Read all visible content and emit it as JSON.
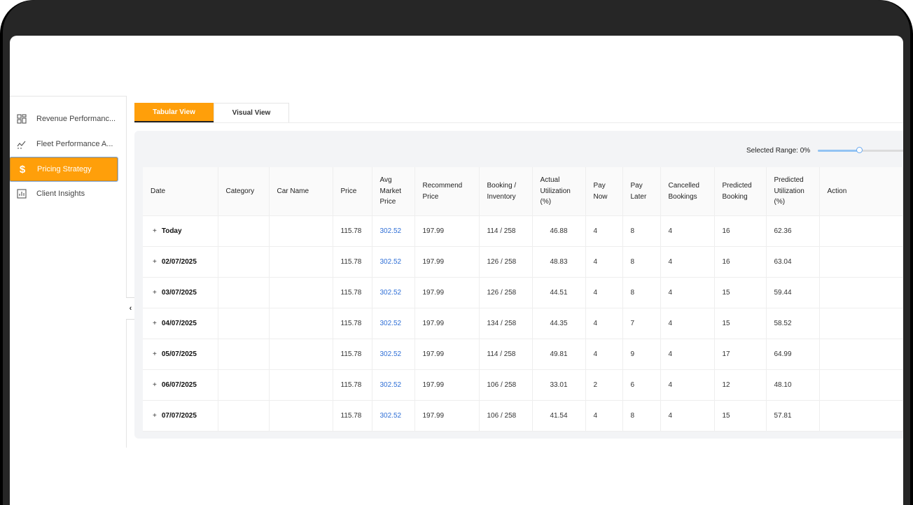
{
  "sidebar": {
    "items": [
      {
        "label": "Revenue Performanc...",
        "icon": "dashboard-grid-icon"
      },
      {
        "label": "Fleet Performance A...",
        "icon": "trend-line-icon"
      },
      {
        "label": "Pricing Strategy",
        "icon": "dollar-icon",
        "active": true
      },
      {
        "label": "Client Insights",
        "icon": "report-chart-icon"
      }
    ]
  },
  "collapse_glyph": "‹",
  "tabs": [
    {
      "label": "Tabular View",
      "active": true
    },
    {
      "label": "Visual View",
      "active": false
    }
  ],
  "range": {
    "label": "Selected Range: 0%",
    "value_percent": 0
  },
  "table": {
    "headers": [
      "Date",
      "Category",
      "Car Name",
      "Price",
      "Avg Market Price",
      "Recommend Price",
      "Booking / Inventory",
      "Actual Utilization (%)",
      "Pay Now",
      "Pay Later",
      "Cancelled Bookings",
      "Predicted Booking",
      "Predicted Utilization (%)",
      "Action"
    ],
    "expand_glyph": "+",
    "rows": [
      {
        "date": "Today",
        "category": "",
        "car_name": "",
        "price": "115.78",
        "avg_market": "302.52",
        "recommend": "197.99",
        "booking": "114 / 258",
        "actual_util": "46.88",
        "pay_now": "4",
        "pay_later": "8",
        "cancelled": "4",
        "pred_booking": "16",
        "pred_util": "62.36",
        "action": ""
      },
      {
        "date": "02/07/2025",
        "category": "",
        "car_name": "",
        "price": "115.78",
        "avg_market": "302.52",
        "recommend": "197.99",
        "booking": "126 / 258",
        "actual_util": "48.83",
        "pay_now": "4",
        "pay_later": "8",
        "cancelled": "4",
        "pred_booking": "16",
        "pred_util": "63.04",
        "action": ""
      },
      {
        "date": "03/07/2025",
        "category": "",
        "car_name": "",
        "price": "115.78",
        "avg_market": "302.52",
        "recommend": "197.99",
        "booking": "126 / 258",
        "actual_util": "44.51",
        "pay_now": "4",
        "pay_later": "8",
        "cancelled": "4",
        "pred_booking": "15",
        "pred_util": "59.44",
        "action": ""
      },
      {
        "date": "04/07/2025",
        "category": "",
        "car_name": "",
        "price": "115.78",
        "avg_market": "302.52",
        "recommend": "197.99",
        "booking": "134 / 258",
        "actual_util": "44.35",
        "pay_now": "4",
        "pay_later": "7",
        "cancelled": "4",
        "pred_booking": "15",
        "pred_util": "58.52",
        "action": ""
      },
      {
        "date": "05/07/2025",
        "category": "",
        "car_name": "",
        "price": "115.78",
        "avg_market": "302.52",
        "recommend": "197.99",
        "booking": "114 / 258",
        "actual_util": "49.81",
        "pay_now": "4",
        "pay_later": "9",
        "cancelled": "4",
        "pred_booking": "17",
        "pred_util": "64.99",
        "action": ""
      },
      {
        "date": "06/07/2025",
        "category": "",
        "car_name": "",
        "price": "115.78",
        "avg_market": "302.52",
        "recommend": "197.99",
        "booking": "106 / 258",
        "actual_util": "33.01",
        "pay_now": "2",
        "pay_later": "6",
        "cancelled": "4",
        "pred_booking": "12",
        "pred_util": "48.10",
        "action": ""
      },
      {
        "date": "07/07/2025",
        "category": "",
        "car_name": "",
        "price": "115.78",
        "avg_market": "302.52",
        "recommend": "197.99",
        "booking": "106 / 258",
        "actual_util": "41.54",
        "pay_now": "4",
        "pay_later": "8",
        "cancelled": "4",
        "pred_booking": "15",
        "pred_util": "57.81",
        "action": ""
      }
    ]
  },
  "colors": {
    "accent": "#ff9f0a",
    "link": "#2f6fd6",
    "panel_bg": "#f3f4f6"
  }
}
